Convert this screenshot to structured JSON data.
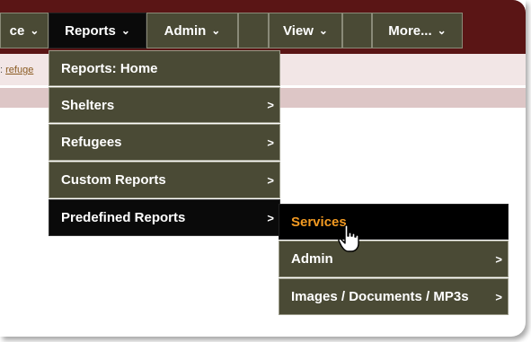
{
  "nav": {
    "items": [
      {
        "label": "ce",
        "arrow": "⌄"
      },
      {
        "label": "Reports",
        "arrow": "⌄"
      },
      {
        "label": "Admin",
        "arrow": "⌄"
      },
      {
        "label": "",
        "arrow": ""
      },
      {
        "label": "View",
        "arrow": "⌄"
      },
      {
        "label": "",
        "arrow": ""
      },
      {
        "label": "More...",
        "arrow": "⌄"
      }
    ]
  },
  "breadcrumb": {
    "prefix": ":",
    "link": "refuge"
  },
  "reports_menu": {
    "items": [
      {
        "label": "Reports: Home",
        "has_submenu": false
      },
      {
        "label": "Shelters",
        "has_submenu": true
      },
      {
        "label": "Refugees",
        "has_submenu": true
      },
      {
        "label": "Custom Reports",
        "has_submenu": true
      },
      {
        "label": "Predefined Reports",
        "has_submenu": true
      }
    ],
    "submenu_arrow": ">"
  },
  "predefined_submenu": {
    "items": [
      {
        "label": "Services",
        "has_submenu": false
      },
      {
        "label": "Admin",
        "has_submenu": true
      },
      {
        "label": "Images / Documents / MP3s",
        "has_submenu": true
      }
    ]
  },
  "colors": {
    "navbar_bg": "#5a1515",
    "menu_bg": "#4a4a35",
    "active_bg": "#0a0a0a",
    "highlight_text": "#f29a22"
  },
  "icons": {
    "cursor": "hand-pointer-icon"
  }
}
